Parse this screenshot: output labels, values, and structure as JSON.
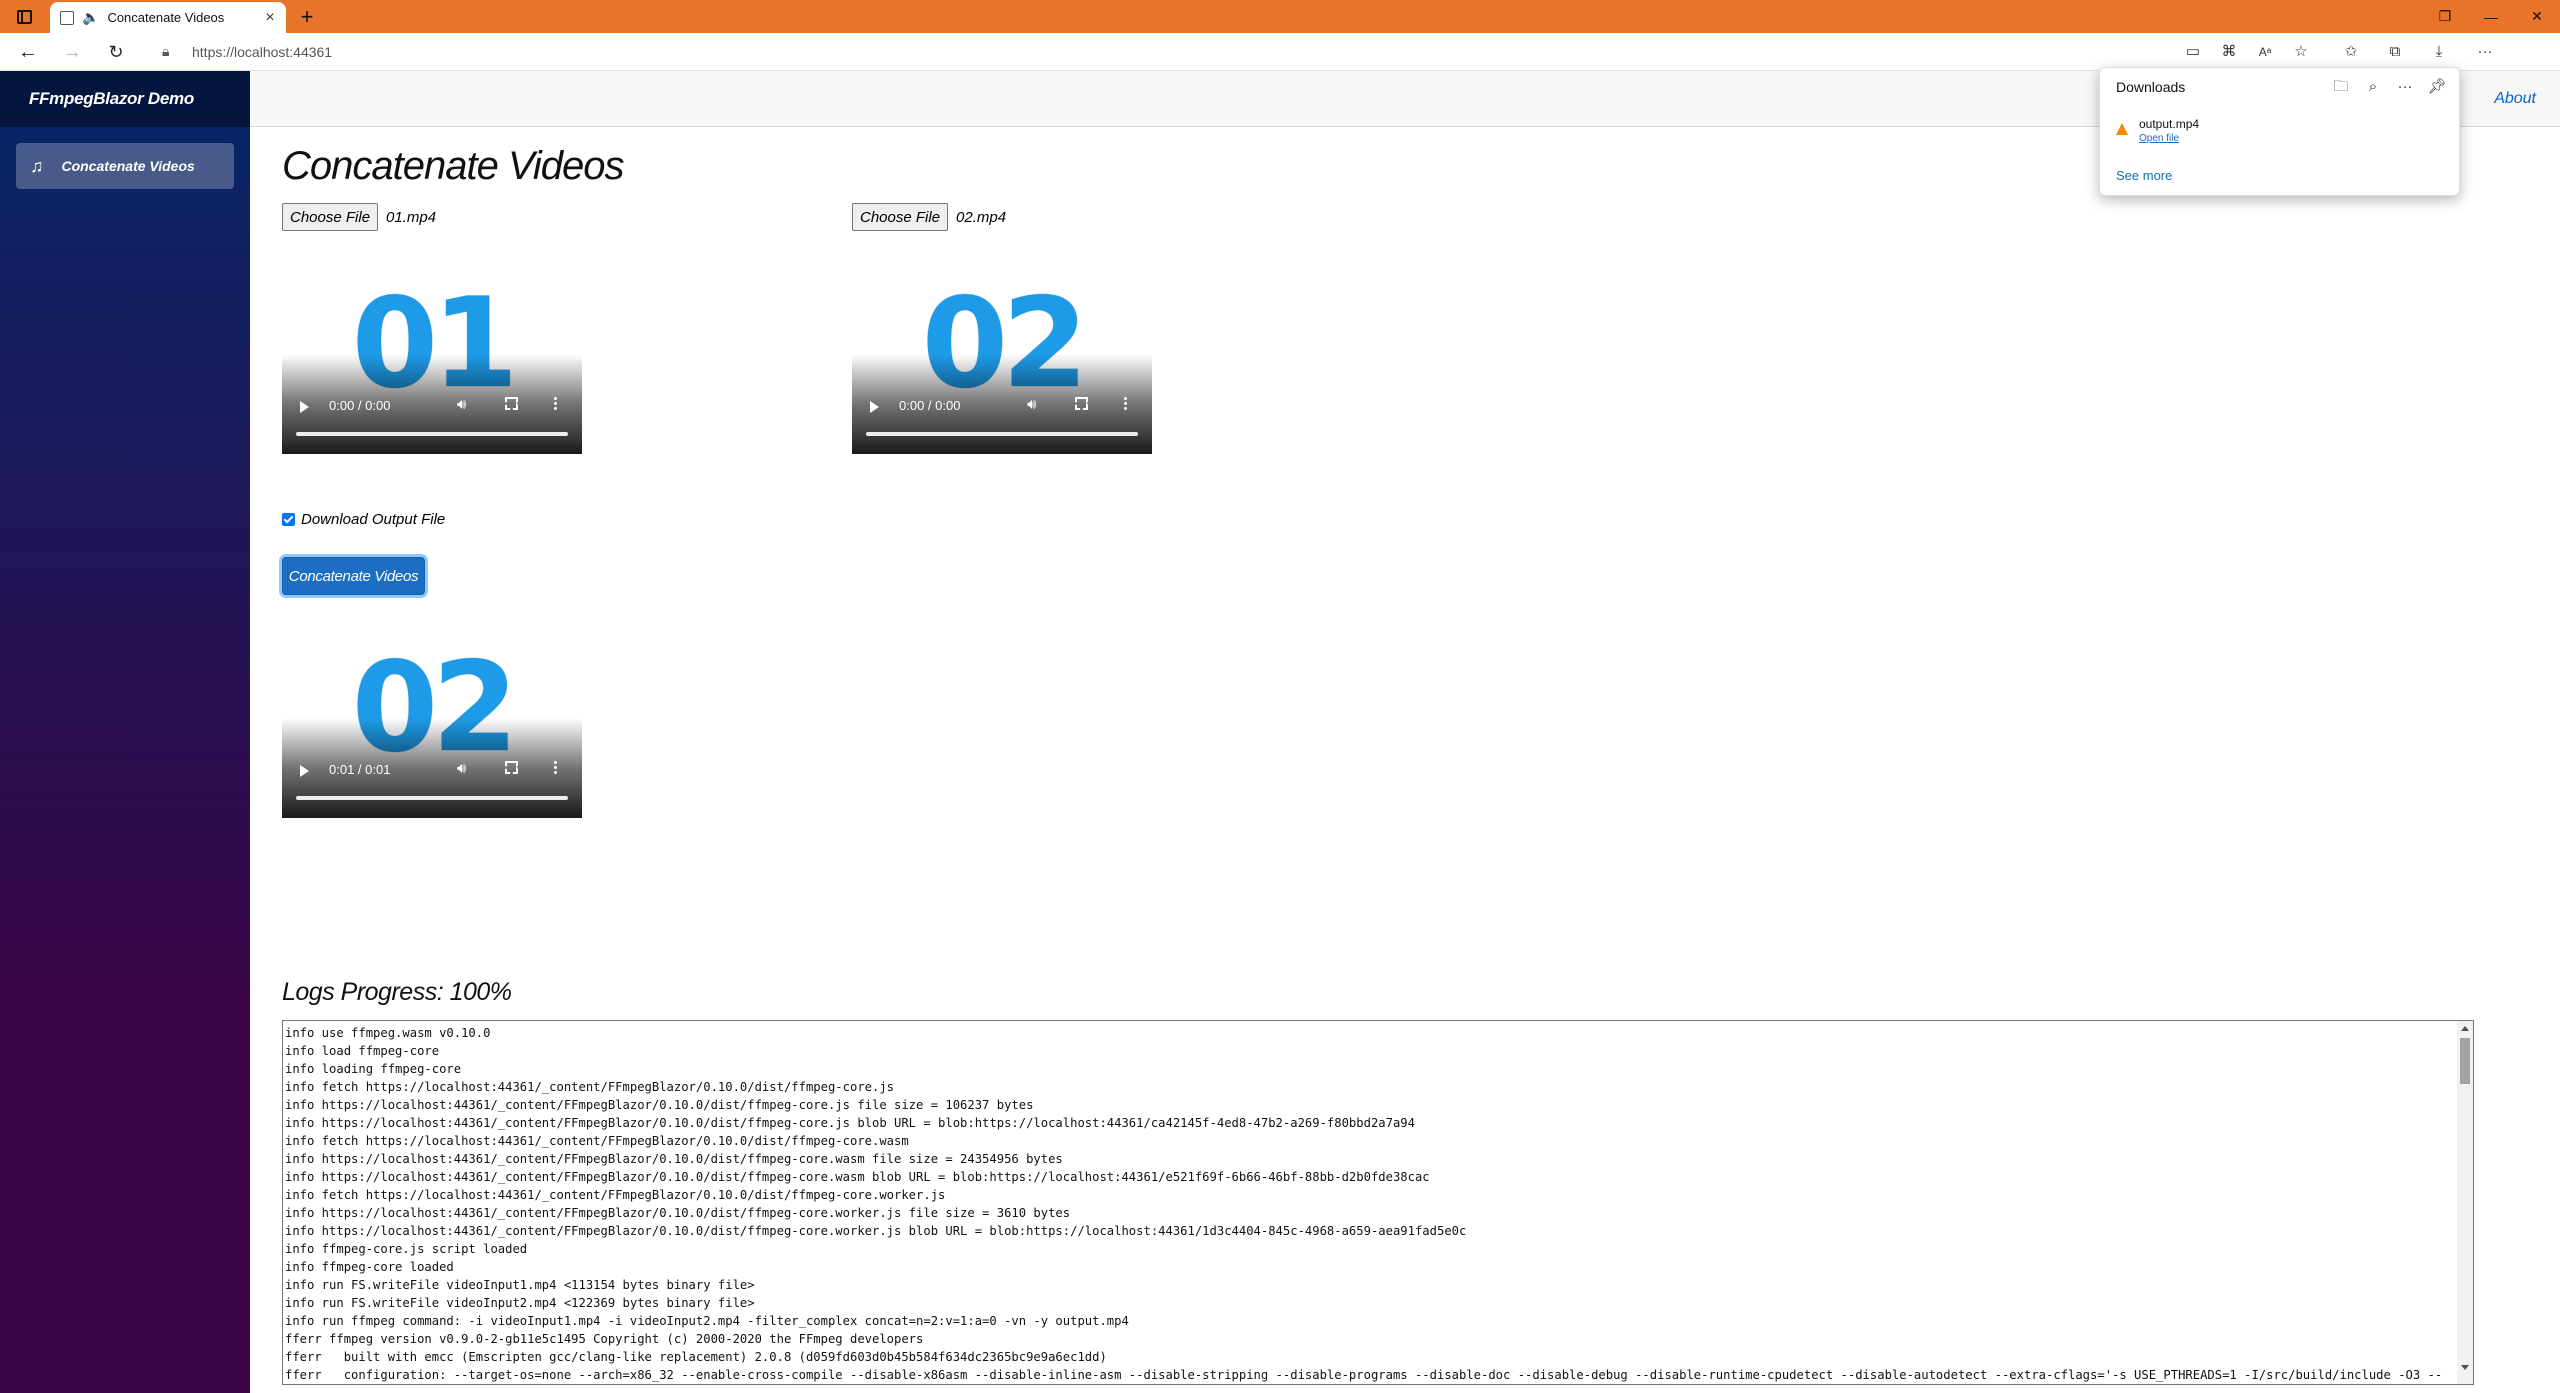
{
  "browser": {
    "tab_title": "Concatenate Videos",
    "tab_close": "×",
    "new_tab": "+",
    "url": "https://localhost:44361",
    "window_minimize": "—",
    "window_restore": "❐",
    "window_close": "✕"
  },
  "downloads": {
    "title": "Downloads",
    "file_name": "output.mp4",
    "open_file_label": "Open file",
    "see_more_label": "See more"
  },
  "sidebar": {
    "brand": "FFmpegBlazor Demo",
    "items": [
      {
        "label": "Concatenate Videos",
        "icon": "music-note-icon"
      }
    ]
  },
  "top_row": {
    "about_label": "About"
  },
  "main": {
    "title": "Concatenate Videos",
    "file_inputs": [
      {
        "button_label": "Choose File",
        "file_name": "01.mp4"
      },
      {
        "button_label": "Choose File",
        "file_name": "02.mp4"
      }
    ],
    "videos": [
      {
        "poster_text": "01",
        "time": "0:00 / 0:00"
      },
      {
        "poster_text": "02",
        "time": "0:00 / 0:00"
      },
      {
        "poster_text": "02",
        "time": "0:01 / 0:01"
      }
    ],
    "download_checkbox_label": "Download Output File",
    "download_checked": true,
    "concat_button_label": "Concatenate Videos",
    "logs_title": "Logs Progress: 100%",
    "logs": [
      "info use ffmpeg.wasm v0.10.0",
      "info load ffmpeg-core",
      "info loading ffmpeg-core",
      "info fetch https://localhost:44361/_content/FFmpegBlazor/0.10.0/dist/ffmpeg-core.js",
      "info https://localhost:44361/_content/FFmpegBlazor/0.10.0/dist/ffmpeg-core.js file size = 106237 bytes",
      "info https://localhost:44361/_content/FFmpegBlazor/0.10.0/dist/ffmpeg-core.js blob URL = blob:https://localhost:44361/ca42145f-4ed8-47b2-a269-f80bbd2a7a94",
      "info fetch https://localhost:44361/_content/FFmpegBlazor/0.10.0/dist/ffmpeg-core.wasm",
      "info https://localhost:44361/_content/FFmpegBlazor/0.10.0/dist/ffmpeg-core.wasm file size = 24354956 bytes",
      "info https://localhost:44361/_content/FFmpegBlazor/0.10.0/dist/ffmpeg-core.wasm blob URL = blob:https://localhost:44361/e521f69f-6b66-46bf-88bb-d2b0fde38cac",
      "info fetch https://localhost:44361/_content/FFmpegBlazor/0.10.0/dist/ffmpeg-core.worker.js",
      "info https://localhost:44361/_content/FFmpegBlazor/0.10.0/dist/ffmpeg-core.worker.js file size = 3610 bytes",
      "info https://localhost:44361/_content/FFmpegBlazor/0.10.0/dist/ffmpeg-core.worker.js blob URL = blob:https://localhost:44361/1d3c4404-845c-4968-a659-aea91fad5e0c",
      "info ffmpeg-core.js script loaded",
      "info ffmpeg-core loaded",
      "info run FS.writeFile videoInput1.mp4 <113154 bytes binary file>",
      "info run FS.writeFile videoInput2.mp4 <122369 bytes binary file>",
      "info run ffmpeg command: -i videoInput1.mp4 -i videoInput2.mp4 -filter_complex concat=n=2:v=1:a=0 -vn -y output.mp4",
      "fferr ffmpeg version v0.9.0-2-gb11e5c1495 Copyright (c) 2000-2020 the FFmpeg developers",
      "fferr   built with emcc (Emscripten gcc/clang-like replacement) 2.0.8 (d059fd603d0b45b584f634dc2365bc9e9a6ec1dd)",
      "fferr   configuration: --target-os=none --arch=x86_32 --enable-cross-compile --disable-x86asm --disable-inline-asm --disable-stripping --disable-programs --disable-doc --disable-debug --disable-runtime-cpudetect --disable-autodetect --extra-cflags='-s USE_PTHREADS=1 -I/src/build/include -O3 --"
    ]
  },
  "colors": {
    "titlebar": "#e8732b",
    "sidebar_top": "#052767",
    "sidebar_bottom": "#3a0647",
    "primary_button": "#1b6ec2",
    "link": "#0366d6",
    "video_number": "#1e9be8"
  }
}
